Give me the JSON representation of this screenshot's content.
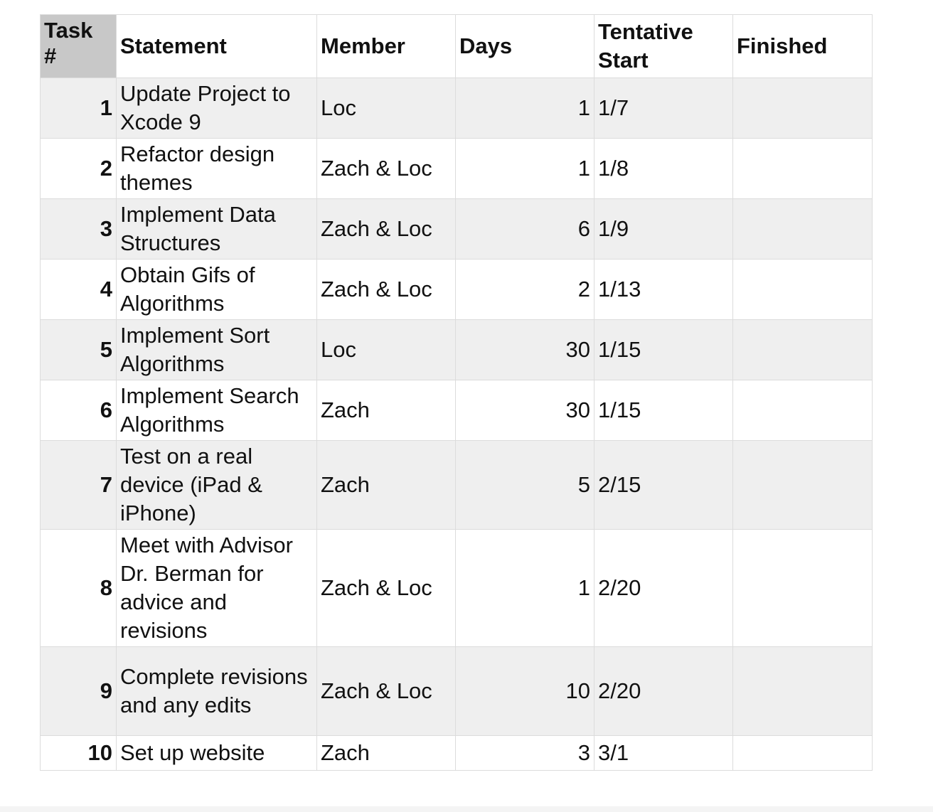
{
  "table": {
    "headers": {
      "task": "Task\n#",
      "statement": "Statement",
      "member": "Member",
      "days": "Days",
      "tentative_start": "Tentative\nStart",
      "finished": "Finished"
    },
    "rows": [
      {
        "task": "1",
        "statement": "Update Project to Xcode 9",
        "member": "Loc",
        "days": "1",
        "start": "1/7",
        "finished": ""
      },
      {
        "task": "2",
        "statement": "Refactor design themes",
        "member": "Zach & Loc",
        "days": "1",
        "start": "1/8",
        "finished": ""
      },
      {
        "task": "3",
        "statement": "Implement Data Structures",
        "member": "Zach & Loc",
        "days": "6",
        "start": "1/9",
        "finished": ""
      },
      {
        "task": "4",
        "statement": "Obtain Gifs of Algorithms",
        "member": "Zach & Loc",
        "days": "2",
        "start": "1/13",
        "finished": ""
      },
      {
        "task": "5",
        "statement": "Implement Sort Algorithms",
        "member": "Loc",
        "days": "30",
        "start": "1/15",
        "finished": ""
      },
      {
        "task": "6",
        "statement": "Implement Search Algorithms",
        "member": "Zach",
        "days": "30",
        "start": "1/15",
        "finished": ""
      },
      {
        "task": "7",
        "statement": "Test on a real device (iPad & iPhone)",
        "member": "Zach",
        "days": "5",
        "start": "2/15",
        "finished": ""
      },
      {
        "task": "8",
        "statement": "Meet with Advisor Dr. Berman for advice and revisions",
        "member": "Zach & Loc",
        "days": "1",
        "start": "2/20",
        "finished": ""
      },
      {
        "task": "9",
        "statement": "Complete revisions and any edits",
        "member": "Zach & Loc",
        "days": "10",
        "start": "2/20",
        "finished": ""
      },
      {
        "task": "10",
        "statement": "Set up website",
        "member": "Zach",
        "days": "3",
        "start": "3/1",
        "finished": ""
      }
    ]
  }
}
